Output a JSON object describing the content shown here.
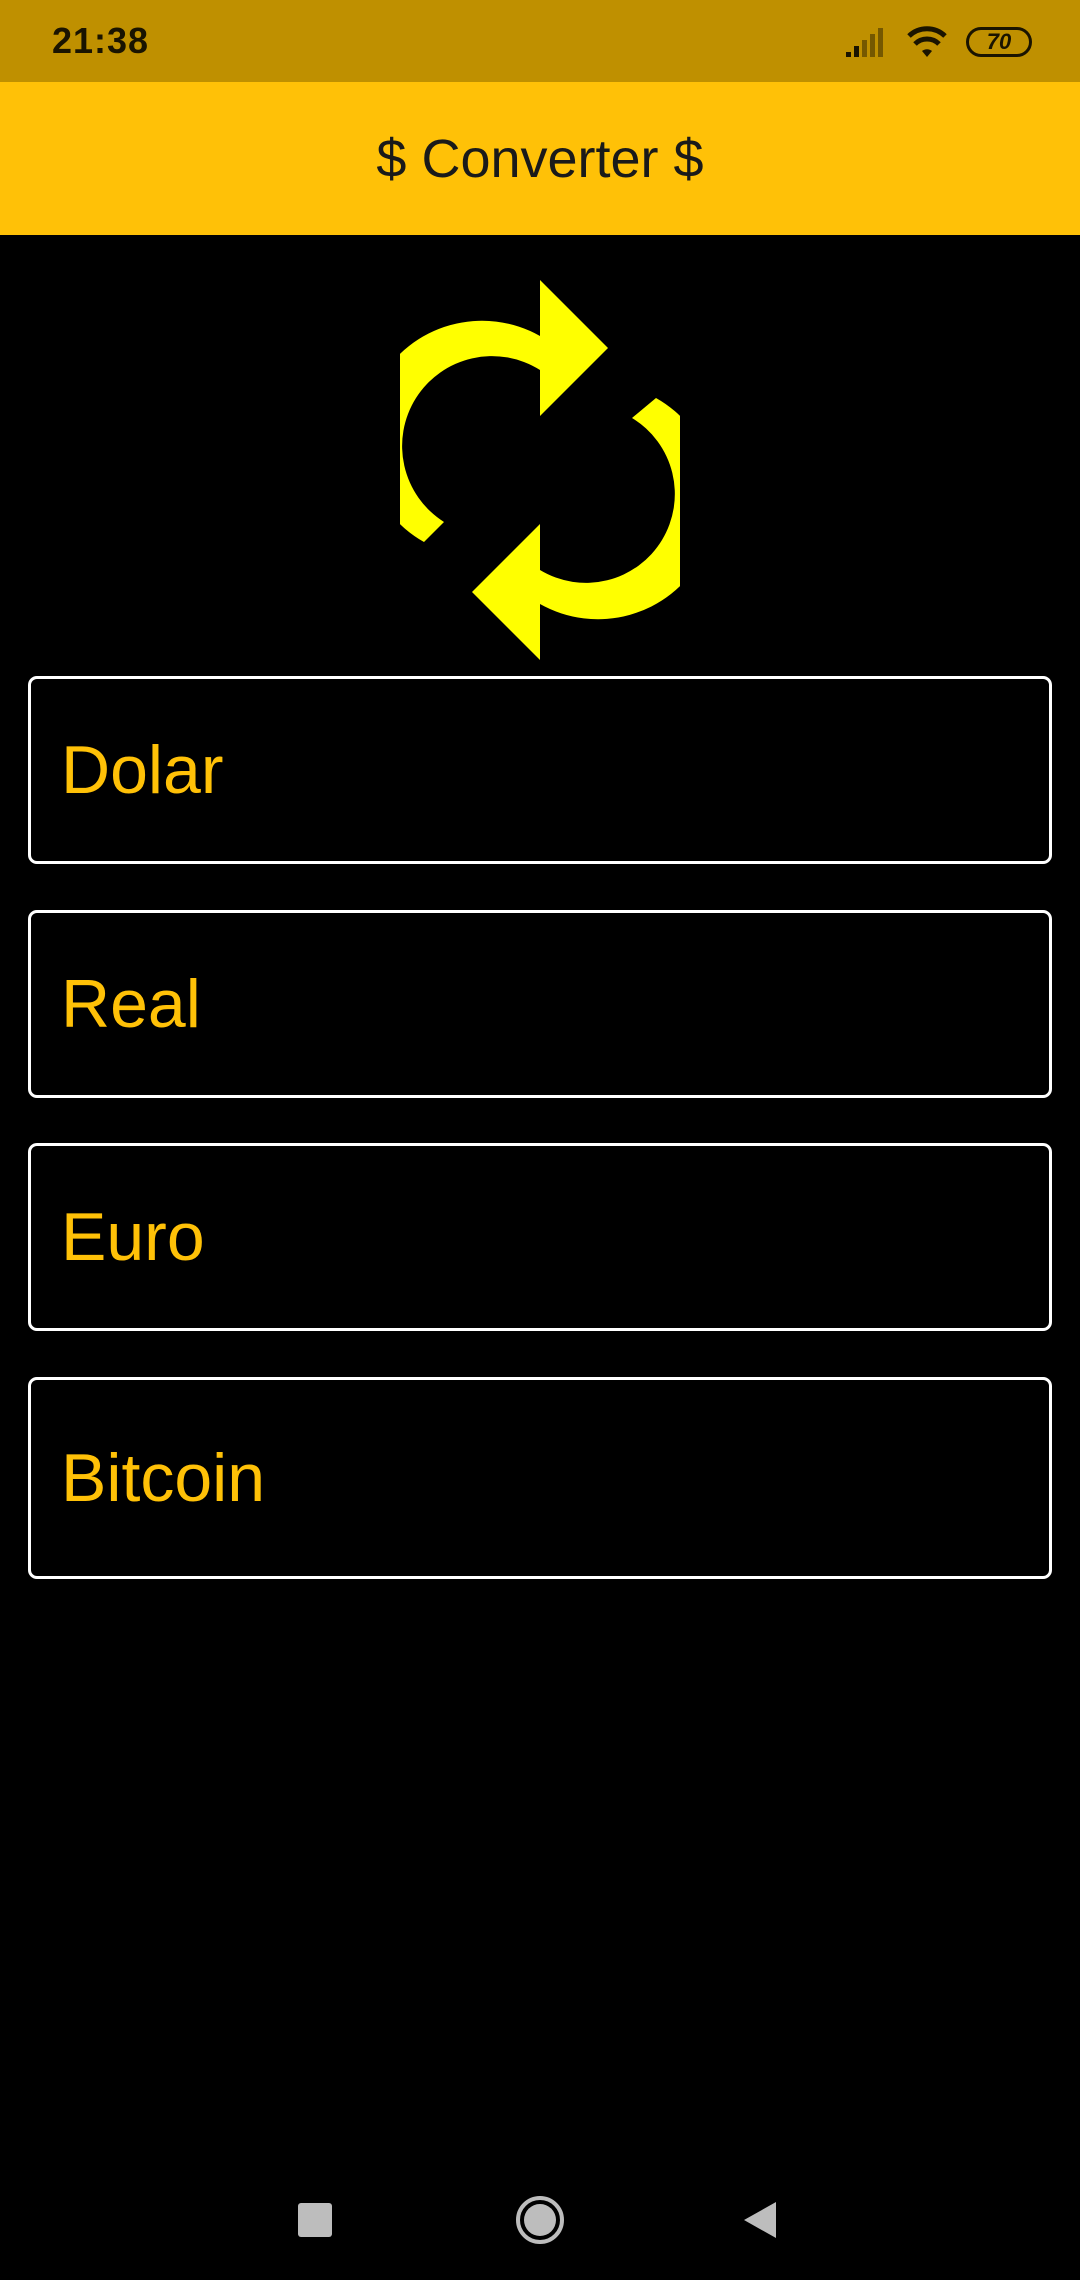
{
  "status_bar": {
    "time": "21:38",
    "battery": "70",
    "icons": [
      "signal-icon",
      "wifi-icon",
      "battery-icon"
    ]
  },
  "app_bar": {
    "title": "$ Converter $",
    "color": "#FFC107"
  },
  "logo": {
    "icon": "refresh-arrows-icon",
    "color": "#FFFF00"
  },
  "fields": [
    {
      "label": "Dolar"
    },
    {
      "label": "Real"
    },
    {
      "label": "Euro"
    },
    {
      "label": "Bitcoin"
    }
  ],
  "nav_bar": {
    "buttons": [
      "recents-icon",
      "home-icon",
      "back-icon"
    ]
  }
}
